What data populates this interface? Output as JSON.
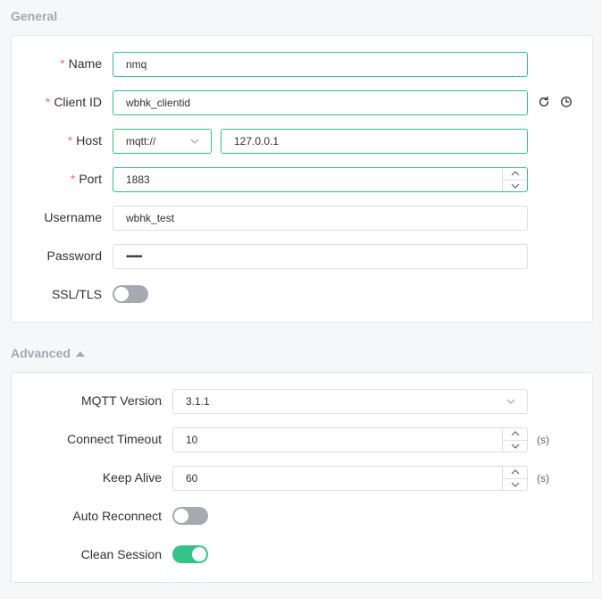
{
  "general": {
    "title": "General",
    "name": {
      "label": "Name",
      "value": "nmq"
    },
    "client_id": {
      "label": "Client ID",
      "value": "wbhk_clientid"
    },
    "host": {
      "label": "Host",
      "protocol": "mqtt://",
      "value": "127.0.0.1"
    },
    "port": {
      "label": "Port",
      "value": "1883"
    },
    "username": {
      "label": "Username",
      "value": "wbhk_test"
    },
    "password": {
      "label": "Password",
      "value": "•••••••"
    },
    "ssl": {
      "label": "SSL/TLS",
      "enabled": false
    },
    "required_mark": "*"
  },
  "advanced": {
    "title": "Advanced",
    "mqtt_version": {
      "label": "MQTT Version",
      "value": "3.1.1"
    },
    "connect_timeout": {
      "label": "Connect Timeout",
      "value": "10",
      "unit": "(s)"
    },
    "keep_alive": {
      "label": "Keep Alive",
      "value": "60",
      "unit": "(s)"
    },
    "auto_reconnect": {
      "label": "Auto Reconnect",
      "enabled": false
    },
    "clean_session": {
      "label": "Clean Session",
      "enabled": true
    }
  },
  "icons": {
    "refresh": "refresh-icon",
    "history": "clock-icon",
    "chevron": "chevron-down-icon",
    "caret": "caret-up-icon"
  },
  "colors": {
    "accent": "#34c388",
    "required": "#f56c6c",
    "switch_off": "#a5a9b0",
    "section_title": "#a2a9b0"
  }
}
